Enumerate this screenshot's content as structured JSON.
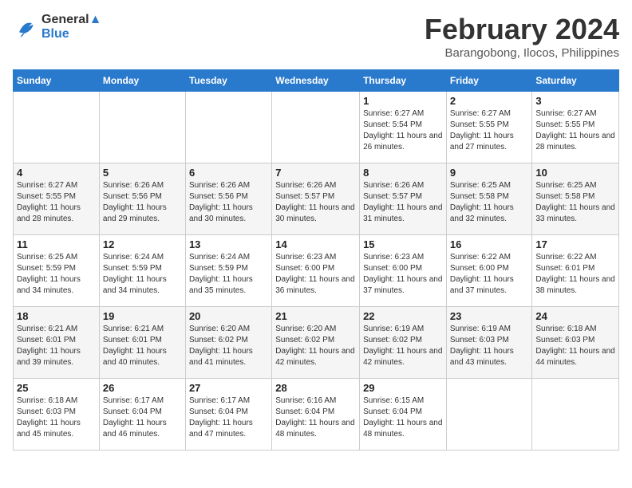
{
  "header": {
    "logo_line1": "General",
    "logo_line2": "Blue",
    "month": "February 2024",
    "location": "Barangobong, Ilocos, Philippines"
  },
  "weekdays": [
    "Sunday",
    "Monday",
    "Tuesday",
    "Wednesday",
    "Thursday",
    "Friday",
    "Saturday"
  ],
  "weeks": [
    [
      {
        "day": "",
        "info": ""
      },
      {
        "day": "",
        "info": ""
      },
      {
        "day": "",
        "info": ""
      },
      {
        "day": "",
        "info": ""
      },
      {
        "day": "1",
        "sunrise": "6:27 AM",
        "sunset": "5:54 PM",
        "daylight": "11 hours and 26 minutes."
      },
      {
        "day": "2",
        "sunrise": "6:27 AM",
        "sunset": "5:55 PM",
        "daylight": "11 hours and 27 minutes."
      },
      {
        "day": "3",
        "sunrise": "6:27 AM",
        "sunset": "5:55 PM",
        "daylight": "11 hours and 28 minutes."
      }
    ],
    [
      {
        "day": "4",
        "sunrise": "6:27 AM",
        "sunset": "5:55 PM",
        "daylight": "11 hours and 28 minutes."
      },
      {
        "day": "5",
        "sunrise": "6:26 AM",
        "sunset": "5:56 PM",
        "daylight": "11 hours and 29 minutes."
      },
      {
        "day": "6",
        "sunrise": "6:26 AM",
        "sunset": "5:56 PM",
        "daylight": "11 hours and 30 minutes."
      },
      {
        "day": "7",
        "sunrise": "6:26 AM",
        "sunset": "5:57 PM",
        "daylight": "11 hours and 30 minutes."
      },
      {
        "day": "8",
        "sunrise": "6:26 AM",
        "sunset": "5:57 PM",
        "daylight": "11 hours and 31 minutes."
      },
      {
        "day": "9",
        "sunrise": "6:25 AM",
        "sunset": "5:58 PM",
        "daylight": "11 hours and 32 minutes."
      },
      {
        "day": "10",
        "sunrise": "6:25 AM",
        "sunset": "5:58 PM",
        "daylight": "11 hours and 33 minutes."
      }
    ],
    [
      {
        "day": "11",
        "sunrise": "6:25 AM",
        "sunset": "5:59 PM",
        "daylight": "11 hours and 34 minutes."
      },
      {
        "day": "12",
        "sunrise": "6:24 AM",
        "sunset": "5:59 PM",
        "daylight": "11 hours and 34 minutes."
      },
      {
        "day": "13",
        "sunrise": "6:24 AM",
        "sunset": "5:59 PM",
        "daylight": "11 hours and 35 minutes."
      },
      {
        "day": "14",
        "sunrise": "6:23 AM",
        "sunset": "6:00 PM",
        "daylight": "11 hours and 36 minutes."
      },
      {
        "day": "15",
        "sunrise": "6:23 AM",
        "sunset": "6:00 PM",
        "daylight": "11 hours and 37 minutes."
      },
      {
        "day": "16",
        "sunrise": "6:22 AM",
        "sunset": "6:00 PM",
        "daylight": "11 hours and 37 minutes."
      },
      {
        "day": "17",
        "sunrise": "6:22 AM",
        "sunset": "6:01 PM",
        "daylight": "11 hours and 38 minutes."
      }
    ],
    [
      {
        "day": "18",
        "sunrise": "6:21 AM",
        "sunset": "6:01 PM",
        "daylight": "11 hours and 39 minutes."
      },
      {
        "day": "19",
        "sunrise": "6:21 AM",
        "sunset": "6:01 PM",
        "daylight": "11 hours and 40 minutes."
      },
      {
        "day": "20",
        "sunrise": "6:20 AM",
        "sunset": "6:02 PM",
        "daylight": "11 hours and 41 minutes."
      },
      {
        "day": "21",
        "sunrise": "6:20 AM",
        "sunset": "6:02 PM",
        "daylight": "11 hours and 42 minutes."
      },
      {
        "day": "22",
        "sunrise": "6:19 AM",
        "sunset": "6:02 PM",
        "daylight": "11 hours and 42 minutes."
      },
      {
        "day": "23",
        "sunrise": "6:19 AM",
        "sunset": "6:03 PM",
        "daylight": "11 hours and 43 minutes."
      },
      {
        "day": "24",
        "sunrise": "6:18 AM",
        "sunset": "6:03 PM",
        "daylight": "11 hours and 44 minutes."
      }
    ],
    [
      {
        "day": "25",
        "sunrise": "6:18 AM",
        "sunset": "6:03 PM",
        "daylight": "11 hours and 45 minutes."
      },
      {
        "day": "26",
        "sunrise": "6:17 AM",
        "sunset": "6:04 PM",
        "daylight": "11 hours and 46 minutes."
      },
      {
        "day": "27",
        "sunrise": "6:17 AM",
        "sunset": "6:04 PM",
        "daylight": "11 hours and 47 minutes."
      },
      {
        "day": "28",
        "sunrise": "6:16 AM",
        "sunset": "6:04 PM",
        "daylight": "11 hours and 48 minutes."
      },
      {
        "day": "29",
        "sunrise": "6:15 AM",
        "sunset": "6:04 PM",
        "daylight": "11 hours and 48 minutes."
      },
      {
        "day": "",
        "info": ""
      },
      {
        "day": "",
        "info": ""
      }
    ]
  ]
}
